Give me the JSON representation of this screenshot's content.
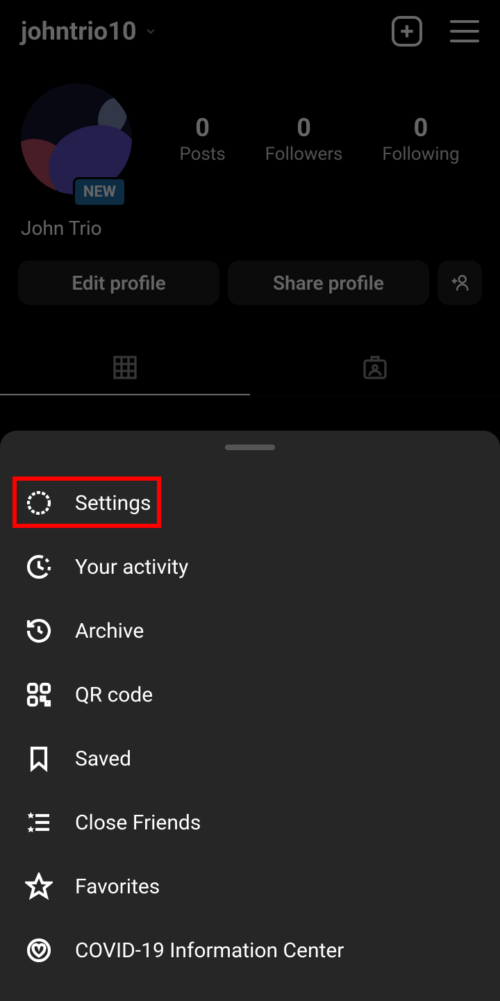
{
  "header": {
    "username": "johntrio10"
  },
  "profile": {
    "new_badge": "NEW",
    "display_name": "John Trio",
    "stats": {
      "posts": {
        "value": "0",
        "label": "Posts"
      },
      "followers": {
        "value": "0",
        "label": "Followers"
      },
      "following": {
        "value": "0",
        "label": "Following"
      }
    }
  },
  "buttons": {
    "edit": "Edit profile",
    "share": "Share profile"
  },
  "menu": {
    "settings": "Settings",
    "activity": "Your activity",
    "archive": "Archive",
    "qr": "QR code",
    "saved": "Saved",
    "close_friends": "Close Friends",
    "favorites": "Favorites",
    "covid": "COVID-19 Information Center"
  }
}
